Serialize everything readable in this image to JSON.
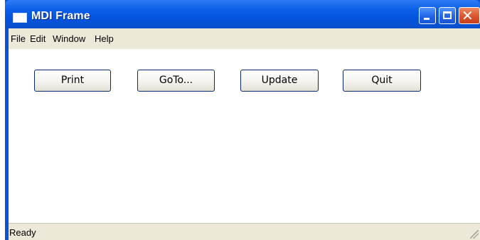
{
  "window": {
    "title": "MDI Frame",
    "controls": {
      "minimize": "minimize",
      "maximize": "maximize",
      "close": "✕"
    }
  },
  "menu": [
    "File",
    "Edit",
    "Window",
    "Help"
  ],
  "buttons": [
    "Print",
    "GoTo...",
    "Update",
    "Quit"
  ],
  "status": {
    "text": "Ready"
  },
  "colors": {
    "titlebar": "#0a5ee8",
    "menubar": "#ece9d8",
    "close": "#d7502a"
  }
}
